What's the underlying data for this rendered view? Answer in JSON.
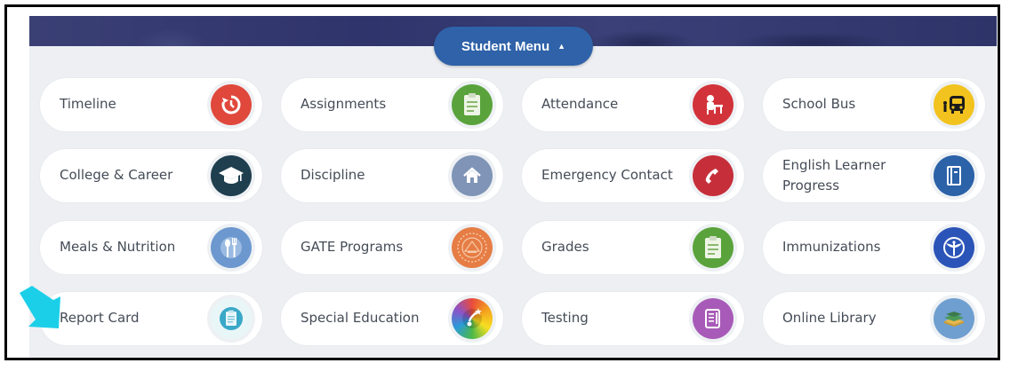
{
  "student_menu": {
    "toggle_label": "Student Menu"
  },
  "tiles": [
    {
      "label": "Timeline",
      "icon": "timeline-icon",
      "color": "#e0483c"
    },
    {
      "label": "Assignments",
      "icon": "assignments-icon",
      "color": "#5aa33c"
    },
    {
      "label": "Attendance",
      "icon": "attendance-icon",
      "color": "#d2333a"
    },
    {
      "label": "School Bus",
      "icon": "school-bus-icon",
      "color": "#f2c31e"
    },
    {
      "label": "College & Career",
      "icon": "graduation-cap-icon",
      "color": "#1f3f4f"
    },
    {
      "label": "Discipline",
      "icon": "home-icon",
      "color": "#7f94b6"
    },
    {
      "label": "Emergency Contact",
      "icon": "phone-icon",
      "color": "#c62f3a"
    },
    {
      "label": "English Learner Progress",
      "icon": "book-icon",
      "color": "#2b62a8"
    },
    {
      "label": "Meals & Nutrition",
      "icon": "utensils-icon",
      "color": "#6c98cf"
    },
    {
      "label": "GATE Programs",
      "icon": "seal-icon",
      "color": "#e67d45"
    },
    {
      "label": "Grades",
      "icon": "grades-icon",
      "color": "#5aa33c"
    },
    {
      "label": "Immunizations",
      "icon": "medical-icon",
      "color": "#2b54b8"
    },
    {
      "label": "Report Card",
      "icon": "report-card-icon",
      "color": "#3aa8c8"
    },
    {
      "label": "Special Education",
      "icon": "special-education-icon",
      "color": "#8a54c8"
    },
    {
      "label": "Testing",
      "icon": "testing-icon",
      "color": "#a85ab8"
    },
    {
      "label": "Online Library",
      "icon": "books-icon",
      "color": "#6f9fd0"
    }
  ],
  "callout": {
    "icon": "pointer-arrow-icon",
    "color": "#1ccfe8"
  }
}
